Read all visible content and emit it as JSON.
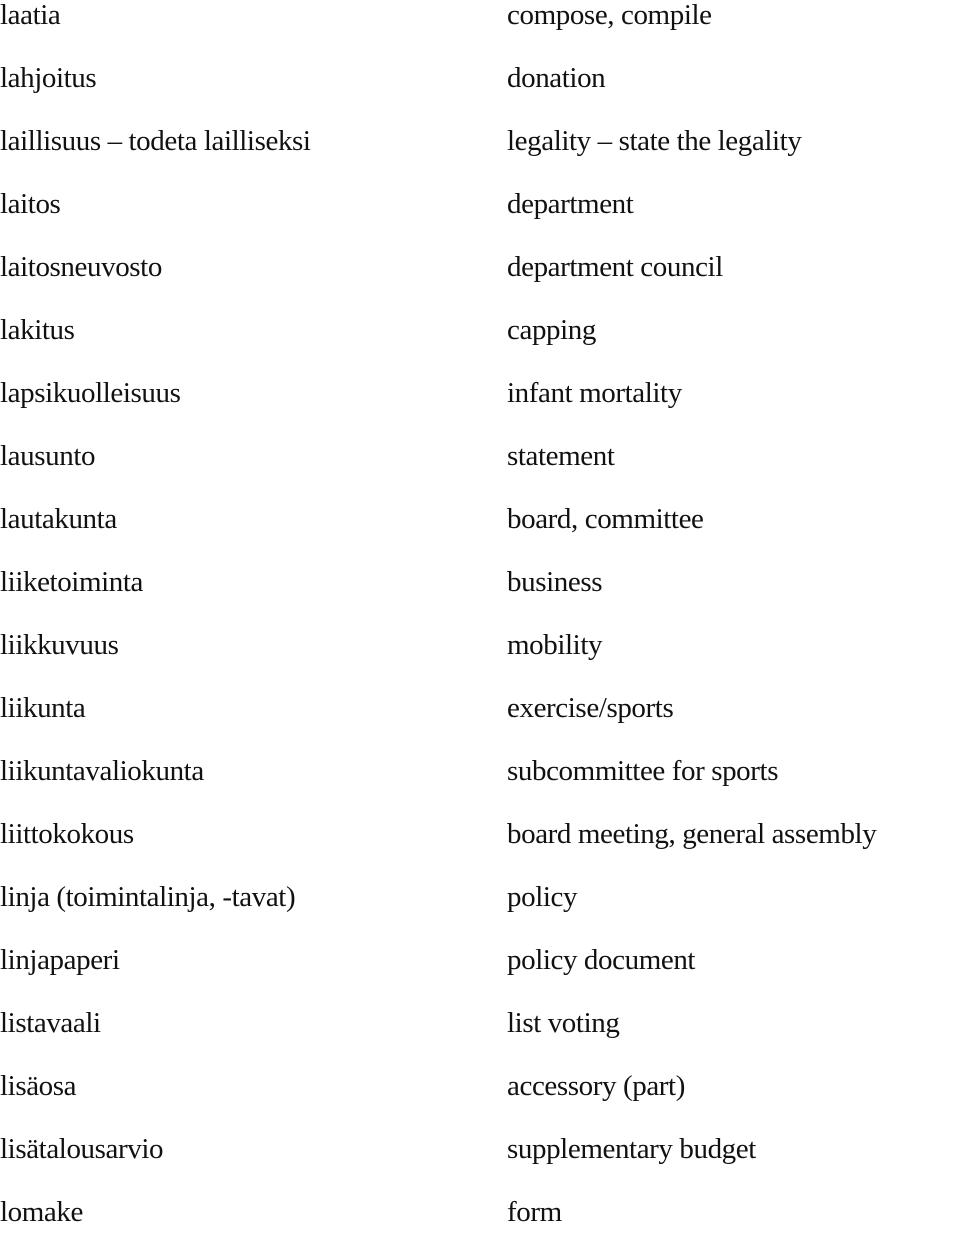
{
  "glossary": {
    "entries": [
      {
        "term": "laatia",
        "definition": "compose, compile"
      },
      {
        "term": "lahjoitus",
        "definition": "donation"
      },
      {
        "term": "laillisuus – todeta lailliseksi",
        "definition": "legality – state the legality"
      },
      {
        "term": "laitos",
        "definition": "department"
      },
      {
        "term": "laitosneuvosto",
        "definition": "department council"
      },
      {
        "term": "lakitus",
        "definition": "capping"
      },
      {
        "term": "lapsikuolleisuus",
        "definition": "infant mortality"
      },
      {
        "term": "lausunto",
        "definition": "statement"
      },
      {
        "term": "lautakunta",
        "definition": "board, committee"
      },
      {
        "term": "liiketoiminta",
        "definition": "business"
      },
      {
        "term": "liikkuvuus",
        "definition": "mobility"
      },
      {
        "term": "liikunta",
        "definition": "exercise/sports"
      },
      {
        "term": "liikuntavaliokunta",
        "definition": "subcommittee for sports"
      },
      {
        "term": "liittokokous",
        "definition": "board meeting, general assembly"
      },
      {
        "term": "linja (toimintalinja, -tavat)",
        "definition": "policy"
      },
      {
        "term": "linjapaperi",
        "definition": "policy document"
      },
      {
        "term": "listavaali",
        "definition": "list voting"
      },
      {
        "term": "lisäosa",
        "definition": "accessory (part)"
      },
      {
        "term": "lisätalousarvio",
        "definition": "supplementary budget"
      },
      {
        "term": "lomake",
        "definition": "form"
      }
    ]
  }
}
